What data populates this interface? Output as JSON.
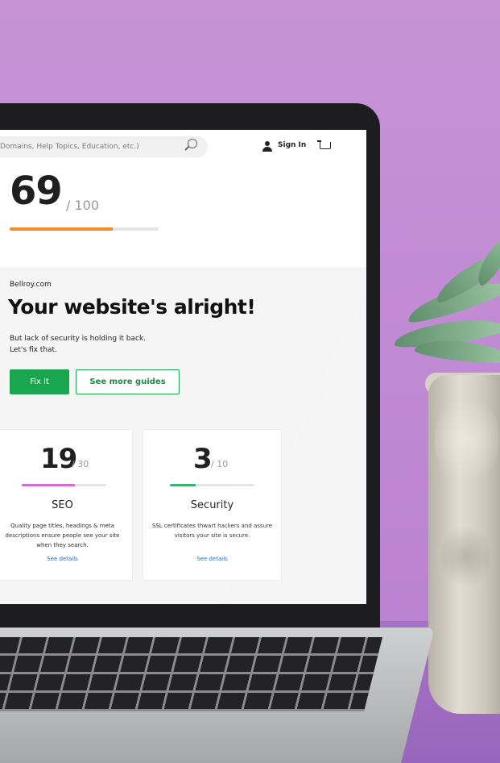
{
  "site": {
    "search": {
      "placeholder": "Domains, Help Topics, Education, etc.)"
    },
    "header": {
      "sign_in_label": "Sign In"
    }
  },
  "report": {
    "score": "69",
    "score_max": "/ 100",
    "score_fraction": 0.69,
    "domain": "Bellroy.com",
    "headline": "Your website's alright!",
    "subtext_line1": "But lack of security is holding it back.",
    "subtext_line2": "Let's fix that.",
    "fix_button": "Fix it",
    "guides_button": "See more guides",
    "accent_color": "#f28b2a"
  },
  "cards": {
    "seo": {
      "score": "19",
      "max": "/ 30",
      "fraction": 0.633,
      "title": "SEO",
      "description": "Quality page titles, headings & meta descriptions ensure people see your site when they search.",
      "link": "See details",
      "color": "#d36bd8"
    },
    "security": {
      "score": "3",
      "max": "/ 10",
      "fraction": 0.3,
      "title": "Security",
      "description": "SSL certificates thwart hackers and assure visitors your site is secure.",
      "link": "See details",
      "color": "#3cb371"
    }
  },
  "icons": [
    "search-icon",
    "user-icon",
    "cart-icon"
  ]
}
